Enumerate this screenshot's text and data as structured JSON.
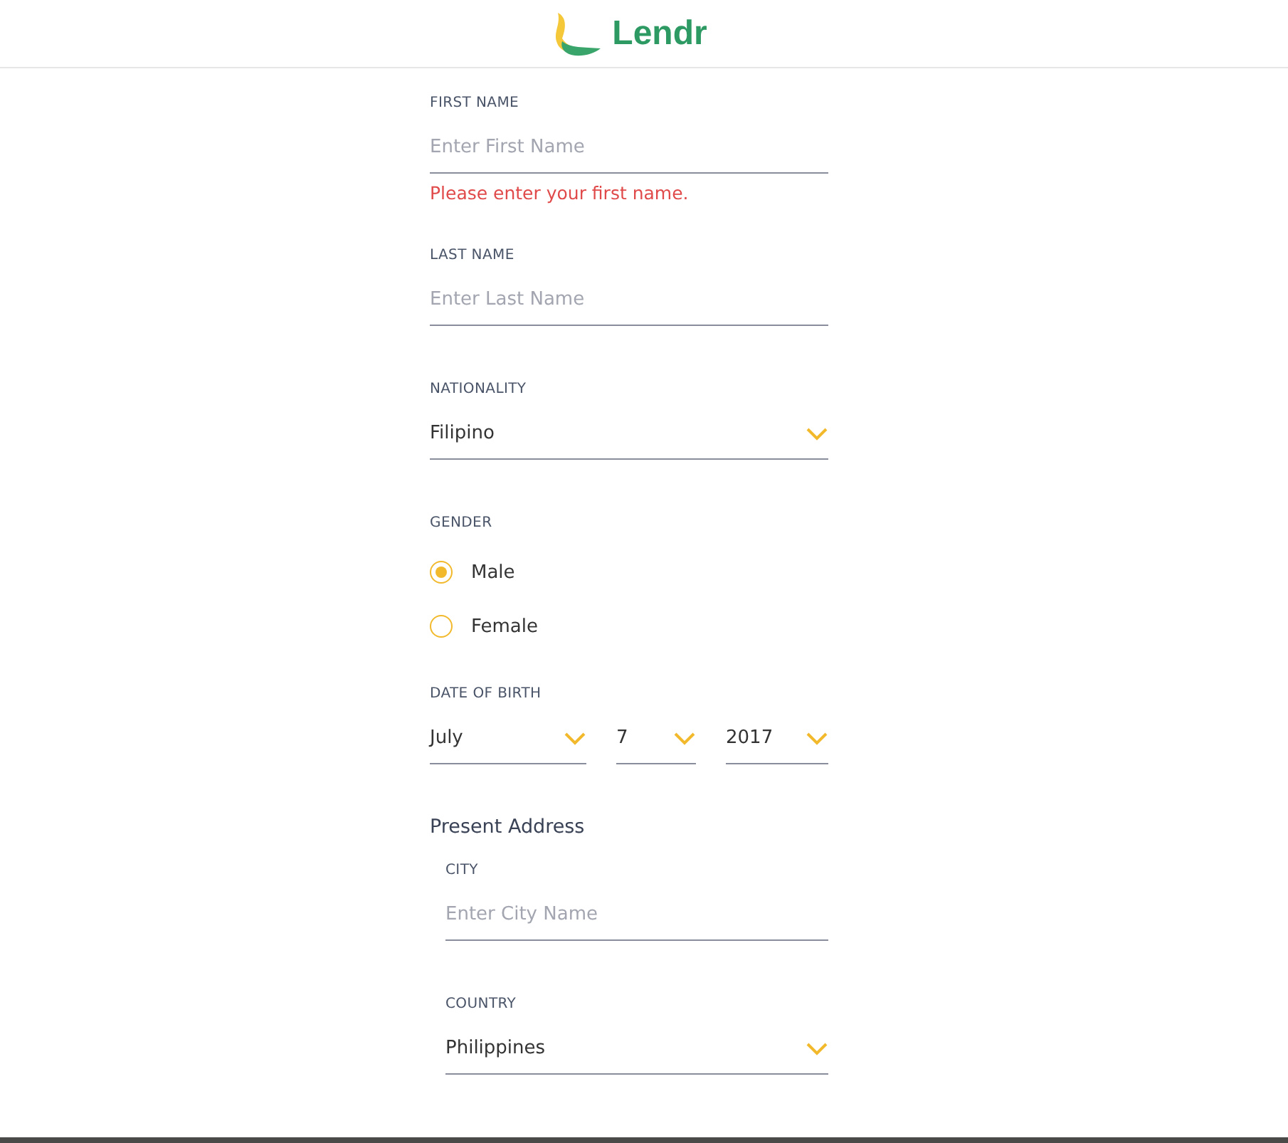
{
  "header": {
    "brand": "Lendr"
  },
  "fields": [
    {
      "kind": "text",
      "label": "FIRST NAME",
      "placeholder": "Enter First Name",
      "error": "Please enter your first name."
    },
    {
      "kind": "text",
      "label": "LAST NAME",
      "placeholder": "Enter Last Name"
    },
    {
      "kind": "select",
      "label": "NATIONALITY",
      "value": "Filipino"
    },
    {
      "kind": "radio",
      "label": "GENDER",
      "options": [
        {
          "label": "Male",
          "selected": true
        },
        {
          "label": "Female",
          "selected": false
        }
      ]
    },
    {
      "kind": "date",
      "label": "DATE OF BIRTH",
      "parts": [
        "July",
        "7",
        "2017"
      ]
    }
  ],
  "address": {
    "title": "Present Address",
    "fields": [
      {
        "kind": "text",
        "label": "CITY",
        "placeholder": "Enter City Name"
      },
      {
        "kind": "select",
        "label": "COUNTRY",
        "value": "Philippines"
      }
    ]
  }
}
